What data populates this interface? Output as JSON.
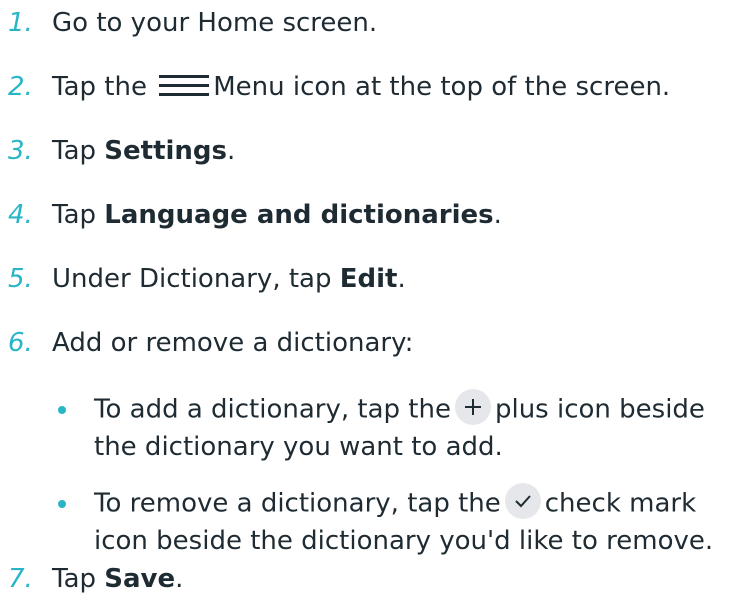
{
  "steps": [
    {
      "number": "1.",
      "text": "Go to your Home screen."
    },
    {
      "number": "2.",
      "before": "Tap the",
      "icon": "menu-icon",
      "after": "Menu icon at the top of the screen."
    },
    {
      "number": "3.",
      "before": "Tap ",
      "bold": "Settings",
      "after": "."
    },
    {
      "number": "4.",
      "before": "Tap ",
      "bold": "Language and dictionaries",
      "after": "."
    },
    {
      "number": "5.",
      "before": "Under Dictionary, tap ",
      "bold": "Edit",
      "after": "."
    },
    {
      "number": "6.",
      "text": "Add or remove a dictionary:"
    },
    {
      "number": "7.",
      "before": "Tap ",
      "bold": "Save",
      "after": "."
    }
  ],
  "bullets": [
    {
      "before": "To add a dictionary, tap the",
      "icon": "plus-icon",
      "after_line1": "plus icon beside",
      "line2": "the dictionary you want to add."
    },
    {
      "before": "To remove a dictionary, tap the",
      "icon": "check-icon",
      "after_line1": "check mark",
      "line2": "icon beside the dictionary you'd like to remove."
    }
  ],
  "colors": {
    "accent": "#28b5c8",
    "text": "#1f2b33",
    "icon_bg": "#e6e7ea"
  }
}
